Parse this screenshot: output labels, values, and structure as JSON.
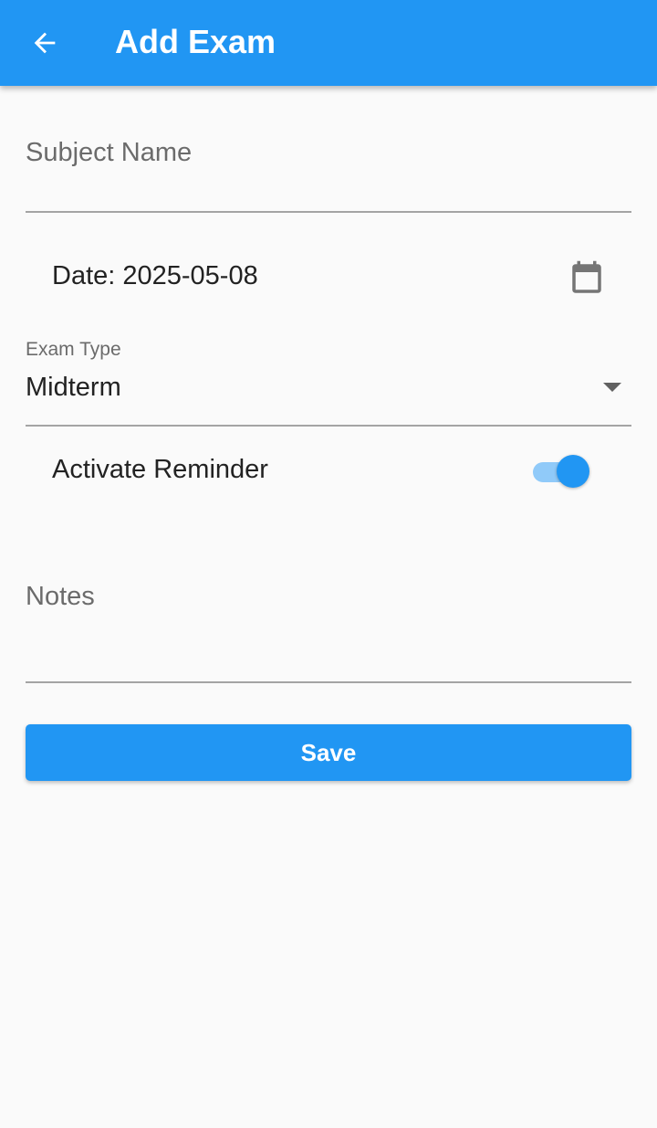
{
  "app_bar": {
    "title": "Add Exam",
    "back_icon": "arrow-back-icon",
    "background_color": "#2196f3"
  },
  "form": {
    "subject": {
      "placeholder": "Subject Name",
      "value": ""
    },
    "date": {
      "text": "Date: 2025-05-08",
      "icon": "calendar-icon"
    },
    "exam_type": {
      "label": "Exam Type",
      "selected": "Midterm",
      "icon": "dropdown-arrow-icon"
    },
    "reminder": {
      "label": "Activate Reminder",
      "enabled": true,
      "accent_color": "#2196f3"
    },
    "notes": {
      "placeholder": "Notes",
      "value": ""
    },
    "save_label": "Save"
  }
}
